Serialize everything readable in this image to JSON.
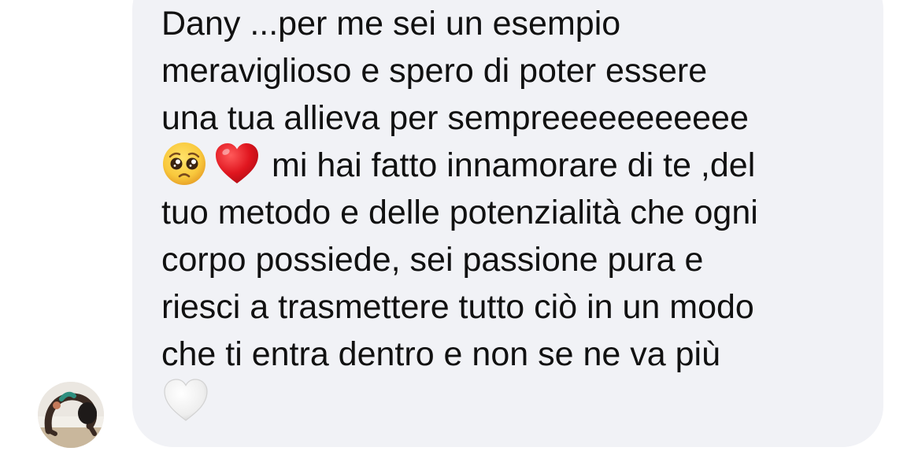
{
  "message": {
    "lines": [
      "Dany ...per me sei un esempio",
      "meraviglioso e spero di poter essere",
      "una tua allieva per sempreeeeeeeeeee",
      "mi hai fatto innamorare di te ,del",
      "tuo metodo e delle potenzialità che ogni",
      "corpo possiede, sei passione pura e",
      "riesci a trasmettere tutto ciò in un modo",
      "che ti entra dentro e non se ne va più"
    ],
    "emojis": [
      "pleading-face-emoji",
      "red-heart-emoji",
      "white-heart-emoji"
    ]
  },
  "colors": {
    "bubble": "#f1f2f6",
    "text": "#111111",
    "background": "#ffffff"
  }
}
